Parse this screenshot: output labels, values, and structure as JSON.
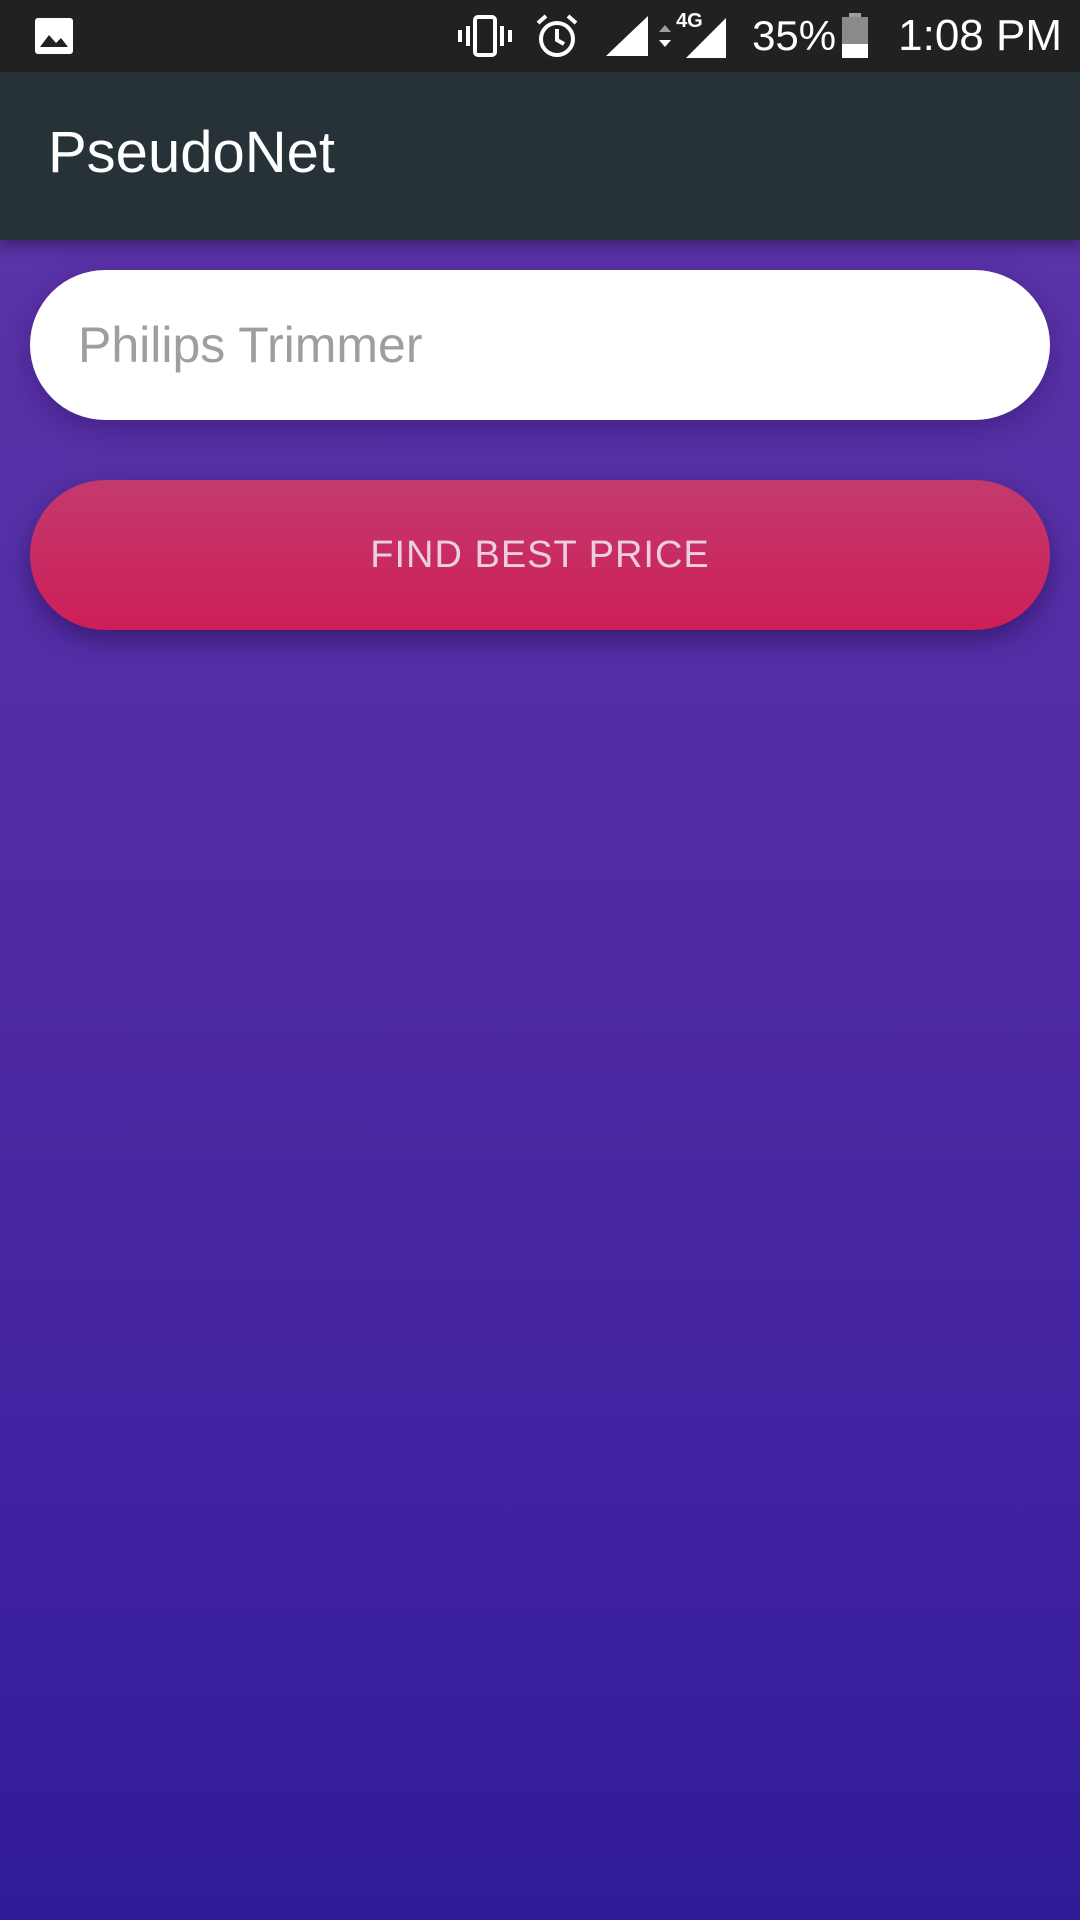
{
  "status_bar": {
    "left_icons": [
      "gallery-icon"
    ],
    "right_icons": [
      "vibrate-icon",
      "alarm-icon",
      "signal-icon",
      "data-arrows-icon",
      "signal-4g-icon",
      "battery-icon"
    ],
    "network_type": "4G",
    "battery_percent": "35%",
    "battery_level": 0.35,
    "time": "1:08 PM",
    "background": "#212121"
  },
  "app_bar": {
    "title": "PseudoNet",
    "background": "#263238"
  },
  "search": {
    "placeholder": "Philips Trimmer",
    "value": ""
  },
  "actions": {
    "find_best_price_label": "FIND BEST PRICE",
    "accent": "#cd1e57"
  },
  "colors": {
    "background_top": "#5f36a8",
    "background_bottom": "#311b98"
  }
}
